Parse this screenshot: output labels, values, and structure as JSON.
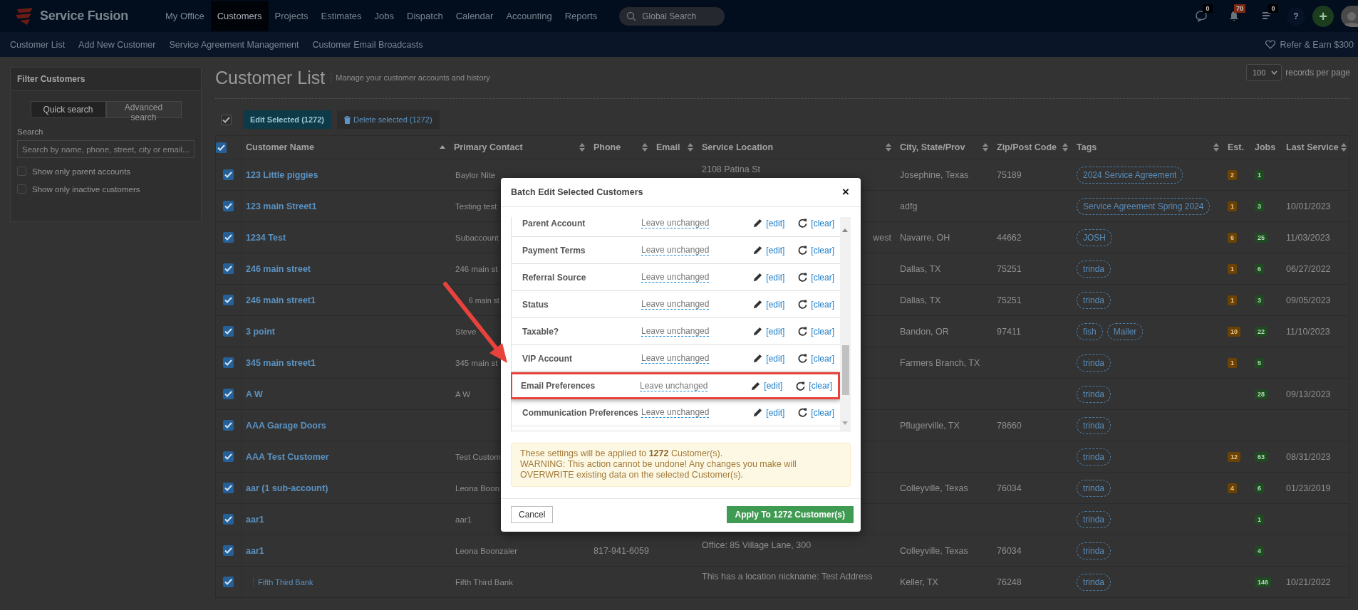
{
  "topbar": {
    "logo": "Service Fusion",
    "menu": [
      {
        "label": "My Office",
        "selected": false
      },
      {
        "label": "Customers",
        "selected": true
      },
      {
        "label": "Projects",
        "selected": false
      },
      {
        "label": "Estimates",
        "selected": false
      },
      {
        "label": "Jobs",
        "selected": false
      },
      {
        "label": "Dispatch",
        "selected": false
      },
      {
        "label": "Calendar",
        "selected": false
      },
      {
        "label": "Accounting",
        "selected": false
      },
      {
        "label": "Reports",
        "selected": false
      }
    ],
    "search": {
      "placeholder": "Global Search"
    },
    "alerts": [
      {
        "kind": "chat",
        "count": "0",
        "color": "#000000"
      },
      {
        "kind": "bell",
        "count": "70",
        "color": "#7c2a16"
      },
      {
        "kind": "list",
        "count": "0",
        "color": "#000000"
      }
    ],
    "help": "?",
    "add": "+"
  },
  "subbar": {
    "items": [
      "Customer List",
      "Add New Customer",
      "Service Agreement Management",
      "Customer Email Broadcasts"
    ],
    "refer": "Refer & Earn $300"
  },
  "filter": {
    "title": "Filter Customers",
    "tabs": [
      {
        "label": "Quick search",
        "selected": true
      },
      {
        "label": "Advanced search",
        "selected": false
      }
    ],
    "search_label": "Search",
    "placeholder": "Search by name, phone, street, city or email...",
    "options": [
      {
        "label": "Show only parent accounts",
        "checked": false
      },
      {
        "label": "Show only inactive customers",
        "checked": false
      }
    ]
  },
  "list": {
    "title": "Customer List",
    "subtitle": "Manage your customer accounts and history",
    "per_page": "100",
    "per_page_label": "records per page",
    "select_all": true,
    "edit_button": "Edit Selected (1272)",
    "delete_button": "Delete selected (1272)"
  },
  "table": {
    "all_checked": true,
    "columns": [
      {
        "label": "Customer Name",
        "sortable": true,
        "sorted": true
      },
      {
        "label": "Primary Contact",
        "sortable": true,
        "sorted": false
      },
      {
        "label": "Phone",
        "sortable": true,
        "sorted": false
      },
      {
        "label": "Email",
        "sortable": true,
        "sorted": false
      },
      {
        "label": "Service Location",
        "sortable": true,
        "sorted": false
      },
      {
        "label": "City, State/Prov",
        "sortable": true,
        "sorted": false
      },
      {
        "label": "Zip/Post Code",
        "sortable": true,
        "sorted": false
      },
      {
        "label": "Tags",
        "sortable": true,
        "sorted": false
      },
      {
        "label": "Est.",
        "sortable": false
      },
      {
        "label": "Jobs",
        "sortable": false
      },
      {
        "label": "Last Service",
        "sortable": true,
        "sorted": false
      }
    ],
    "rows": [
      {
        "checked": true,
        "kind": "account",
        "name": "123 Little piggies",
        "contact": "Baylor Nite",
        "location": "2108 Patina St",
        "city": "Josephine, Texas",
        "zip": "75189",
        "tags": [
          "2024 Service Agreement"
        ],
        "est": "2",
        "jobs": "1"
      },
      {
        "checked": true,
        "kind": "account",
        "name": "123 main Street1",
        "contact": "Testing test",
        "city": "adfg",
        "tags": [
          "Service Agreement Spring 2024"
        ],
        "est": "1",
        "jobs": "3",
        "last": "10/01/2023"
      },
      {
        "checked": true,
        "kind": "account",
        "name": "1234 Test",
        "contact": "Subaccount",
        "location": "west",
        "location_clipped": true,
        "city": "Navarre, OH",
        "zip": "44662",
        "tags": [
          "JOSH"
        ],
        "est": "6",
        "jobs": "25",
        "last": "11/03/2023"
      },
      {
        "checked": true,
        "kind": "account",
        "name": "246 main street",
        "contact": "246 main st",
        "city": "Dallas, TX",
        "zip": "75251",
        "tags": [
          "trinda"
        ],
        "est": "1",
        "jobs": "6",
        "last": "06/27/2022"
      },
      {
        "checked": true,
        "kind": "account",
        "name": "246 main street1",
        "contact": "6 main st",
        "contact_covered": true,
        "city": "Dallas, TX",
        "zip": "75251",
        "tags": [
          "trinda"
        ],
        "est": "1",
        "jobs": "3",
        "last": "09/05/2023"
      },
      {
        "checked": true,
        "kind": "account",
        "name": "3 point",
        "contact": "Steve",
        "city": "Bandon, OR",
        "zip": "97411",
        "tags": [
          "fish",
          "Mailer"
        ],
        "est": "10",
        "jobs": "22",
        "last": "11/10/2023"
      },
      {
        "checked": true,
        "kind": "account",
        "name": "345 main street1",
        "contact": "345 main st",
        "city": "Farmers Branch, TX",
        "tags": [
          "trinda"
        ],
        "est": "1",
        "jobs": "5"
      },
      {
        "checked": true,
        "kind": "account",
        "name": "A W",
        "contact": "A W",
        "tags": [
          "trinda"
        ],
        "jobs": "28",
        "last": "09/13/2023"
      },
      {
        "checked": true,
        "kind": "account",
        "name": "AAA Garage Doors",
        "city": "Pflugerville, TX",
        "zip": "78660",
        "tags": [
          "trinda"
        ]
      },
      {
        "checked": true,
        "kind": "account",
        "name": "AAA Test Customer",
        "contact": "Test Custom",
        "tags": [
          "trinda"
        ],
        "est": "12",
        "jobs": "63",
        "last": "08/31/2023"
      },
      {
        "checked": true,
        "kind": "account",
        "name": "aar  (1 sub-account)",
        "contact": "Leona Boon",
        "city": "Colleyville, Texas",
        "zip": "76034",
        "tags": [
          "trinda"
        ],
        "est": "4",
        "jobs": "6",
        "last": "01/23/2019"
      },
      {
        "checked": true,
        "kind": "account",
        "name": "aar1",
        "contact": "aar1",
        "tags": [
          "trinda"
        ],
        "jobs": "1"
      },
      {
        "checked": true,
        "kind": "account",
        "name": "aar1",
        "contact": "Leona Boonzaier",
        "phone": "817-941-6059",
        "location": "Office: 85 Village Lane, 300",
        "city": "Colleyville, Texas",
        "zip": "76034",
        "tags": [
          "trinda"
        ],
        "jobs": "4"
      },
      {
        "checked": true,
        "kind": "subaccount",
        "name": "Fifth Third Bank",
        "contact": "Fifth Third Bank",
        "location": "This has a location nickname: Test Address",
        "city": "Keller, TX",
        "zip": "76248",
        "tags": [
          "trinda"
        ],
        "jobs": "146",
        "last": "10/21/2022"
      }
    ]
  },
  "modal": {
    "title": "Batch Edit Selected Customers",
    "close": "×",
    "fields": [
      {
        "label": "Parent Account",
        "value": "Leave unchanged",
        "edit": "[edit]",
        "clear": "[clear]",
        "highlighted": false
      },
      {
        "label": "Payment Terms",
        "value": "Leave unchanged",
        "edit": "[edit]",
        "clear": "[clear]",
        "highlighted": false
      },
      {
        "label": "Referral Source",
        "value": "Leave unchanged",
        "edit": "[edit]",
        "clear": "[clear]",
        "highlighted": false
      },
      {
        "label": "Status",
        "value": "Leave unchanged",
        "edit": "[edit]",
        "clear": "[clear]",
        "highlighted": false
      },
      {
        "label": "Taxable?",
        "value": "Leave unchanged",
        "edit": "[edit]",
        "clear": "[clear]",
        "highlighted": false
      },
      {
        "label": "VIP Account",
        "value": "Leave unchanged",
        "edit": "[edit]",
        "clear": "[clear]",
        "highlighted": false
      },
      {
        "label": "Email Preferences",
        "value": "Leave unchanged",
        "edit": "[edit]",
        "clear": "[clear]",
        "highlighted": true
      },
      {
        "label": "Communication Preferences",
        "value": "Leave unchanged",
        "edit": "[edit]",
        "clear": "[clear]",
        "highlighted": false
      }
    ],
    "notice": "These settings will be applied to **1272** Customer(s).",
    "warning": "WARNING: This action cannot be undone! Any changes you make will OVERWRITE existing data on the selected Customer(s).",
    "cancel": "Cancel",
    "apply": "Apply To 1272 Customer(s)"
  }
}
